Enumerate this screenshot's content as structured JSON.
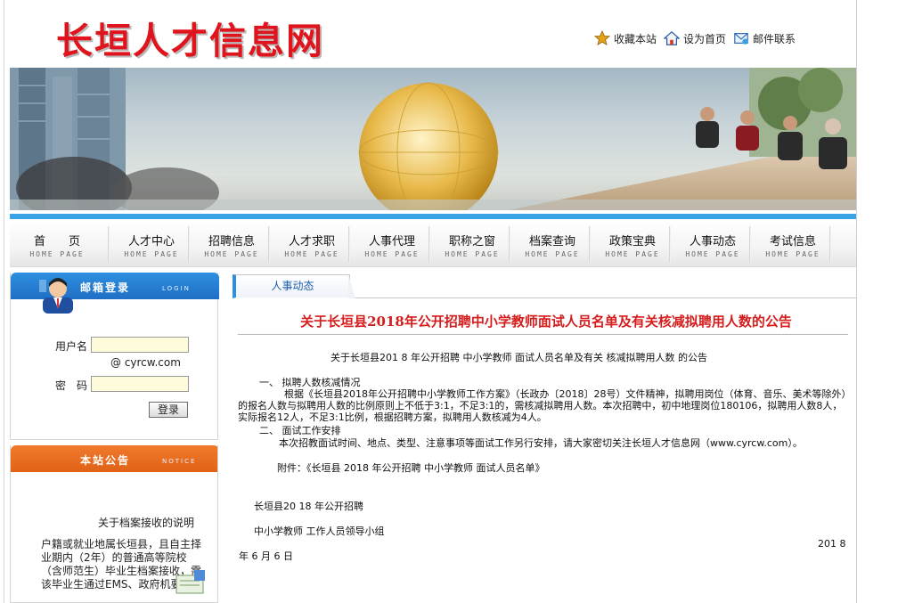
{
  "header": {
    "logo_text": "长垣人才信息网",
    "links": [
      {
        "label": "收藏本站",
        "icon": "star-icon"
      },
      {
        "label": "设为首页",
        "icon": "home-icon"
      },
      {
        "label": "邮件联系",
        "icon": "mail-icon"
      }
    ]
  },
  "nav": {
    "items": [
      {
        "label": "首　　页",
        "sub": "HOME PAGE"
      },
      {
        "label": "人才中心",
        "sub": "HOME PAGE"
      },
      {
        "label": "招聘信息",
        "sub": "HOME PAGE"
      },
      {
        "label": "人才求职",
        "sub": "HOME PAGE"
      },
      {
        "label": "人事代理",
        "sub": "HOME PAGE"
      },
      {
        "label": "职称之窗",
        "sub": "HOME PAGE"
      },
      {
        "label": "档案查询",
        "sub": "HOME PAGE"
      },
      {
        "label": "政策宝典",
        "sub": "HOME PAGE"
      },
      {
        "label": "人事动态",
        "sub": "HOME PAGE"
      },
      {
        "label": "考试信息",
        "sub": "HOME PAGE"
      }
    ]
  },
  "mailbox": {
    "title": "邮箱登录",
    "subtitle": "LOGIN",
    "username_label": "用户名",
    "domain": "@ cyrcw.com",
    "password_label": "密　码",
    "login_button": "登录",
    "username_value": "",
    "password_value": ""
  },
  "notice": {
    "title": "本站公告",
    "subtitle": "NOTICE",
    "item_title": "关于档案接收的说明",
    "item_body": "户籍或就业地属长垣县，且自主择业期内（2年）的普通高等院校（含师范生）毕业生档案接收，需该毕业生通过EMS、政府机要邮寄"
  },
  "main": {
    "tab_label": "人事动态",
    "article_title": "关于长垣县2018年公开招聘中小学教师面试人员名单及有关核减拟聘用人数的公告",
    "lines": {
      "subtitle": "关于长垣县201 8 年公开招聘 中小学教师 面试人员名单及有关 核减拟聘用人数 的公告",
      "s1_head": "一、 拟聘人数核减情况",
      "s1_body": "根据《长垣县2018年公开招聘中小学教师工作方案》（长政办〔2018〕28号）文件精神，拟聘用岗位（体育、音乐、美术等除外）的报名人数与拟聘用人数的比例原则上不低于3:1，不足3:1的，需核减拟聘用人数。本次招聘中，初中地理岗位180106，拟聘用人数8人，实际报名12人，不足3:1比例，根据招聘方案，拟聘用人数核减为4人。",
      "s2_head": "二、 面试工作安排",
      "s2_body": "本次招教面试时间、地点、类型、注意事项等面试工作另行安排，请大家密切关注长垣人才信息网（www.cyrcw.com）。",
      "attach": "附件：《长垣县 2018 年公开招聘 中小学教师 面试人员名单》",
      "sign1": "长垣县20 18 年公开招聘",
      "sign2": "中小学教师 工作人员领导小组",
      "date_year": "201 8",
      "date_rest": "年 6 月 6 日"
    }
  },
  "colors": {
    "logo_red": "#e0141c",
    "title_red": "#d51d1d",
    "accent_blue": "#2e8fe0",
    "notice_orange": "#f07a2c",
    "input_yellow": "#fdfbd9"
  }
}
